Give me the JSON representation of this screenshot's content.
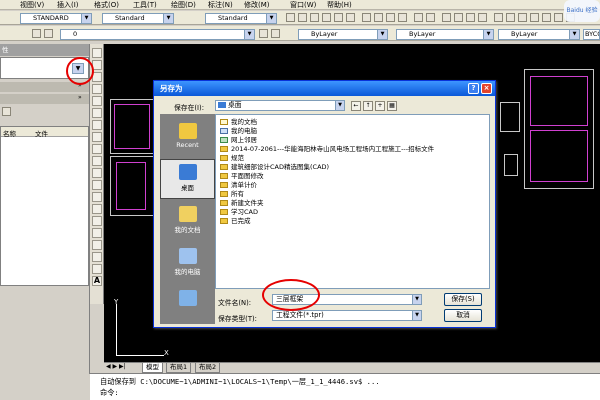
{
  "menu": {
    "items": [
      "视图(V)",
      "插入(I)",
      "格式(O)",
      "工具(T)",
      "绘图(D)",
      "标注(N)",
      "修改(M)",
      "窗口(W)",
      "帮助(H)"
    ]
  },
  "toolbar": {
    "text_style": "STANDARD",
    "dim_style": "Standard",
    "table_style": "Standard",
    "layer_value": "0",
    "color": "ByLayer",
    "linetype": "ByLayer",
    "lineweight": "ByLayer",
    "plot_style": "BYCO"
  },
  "left_panel": {
    "title_fragment": "性",
    "column_headers": [
      "名称",
      "文件"
    ]
  },
  "dialog": {
    "title": "另存为",
    "save_in_label": "保存在(I):",
    "save_in_value": "桌面",
    "places": [
      {
        "label": "Recent",
        "icon": "recent-folder-icon"
      },
      {
        "label": "桌面",
        "icon": "desktop-icon"
      },
      {
        "label": "我的文档",
        "icon": "my-documents-icon"
      },
      {
        "label": "我的电脑",
        "icon": "my-computer-icon"
      },
      {
        "label": "",
        "icon": "network-places-icon"
      }
    ],
    "files": [
      {
        "name": "我的文档",
        "kind": "doc"
      },
      {
        "name": "我的电脑",
        "kind": "pc"
      },
      {
        "name": "网上邻居",
        "kind": "net"
      },
      {
        "name": "2014-07-2061---华能海阳林寺山风电场工程场内工程施工---招标文件",
        "kind": "folder"
      },
      {
        "name": "规范",
        "kind": "folder"
      },
      {
        "name": "建筑细部设计CAD精选图集(CAD)",
        "kind": "folder"
      },
      {
        "name": "平面图修改",
        "kind": "folder"
      },
      {
        "name": "清单计价",
        "kind": "folder"
      },
      {
        "name": "所有",
        "kind": "folder"
      },
      {
        "name": "新建文件夹",
        "kind": "folder"
      },
      {
        "name": "学习CAD",
        "kind": "folder"
      },
      {
        "name": "已完成",
        "kind": "folder"
      }
    ],
    "filename_label": "文件名(N):",
    "filename_value": "三层框架",
    "filetype_label": "保存类型(T):",
    "filetype_value": "工程文件(*.tpr)",
    "save_button": "保存(S)",
    "cancel_button": "取消"
  },
  "canvas": {
    "tabs": [
      "模型",
      "布局1",
      "布局2"
    ]
  },
  "command": {
    "line1": "自动保存到 C:\\DOCUME~1\\ADMINI~1\\LOCALS~1\\Temp\\一层_1_1_4446.sv$ ...",
    "line2": "命令:"
  },
  "watermark": "Baidu 经验",
  "colors": {
    "titlebar": "#0a58d8",
    "annotation_red": "#e60000",
    "canvas_bg": "#000000"
  }
}
